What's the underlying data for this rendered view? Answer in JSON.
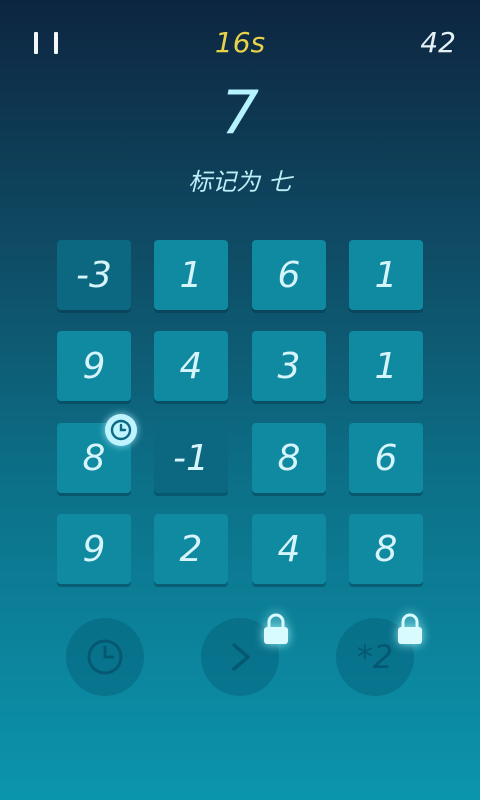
{
  "header": {
    "timer": "16s",
    "score": "42"
  },
  "target": "7",
  "instruction": "标记为 七",
  "grid": [
    [
      "-3",
      "1",
      "6",
      "1"
    ],
    [
      "9",
      "4",
      "3",
      "1"
    ],
    [
      "8",
      "-1",
      "8",
      "6"
    ],
    [
      "9",
      "2",
      "4",
      "8"
    ]
  ],
  "powerups": {
    "x2_label": "*2"
  },
  "colors": {
    "timer": "#e8d24a",
    "target": "#b5f3ff",
    "tile": "#0f8aa0",
    "tile_dark": "#0b6880"
  }
}
